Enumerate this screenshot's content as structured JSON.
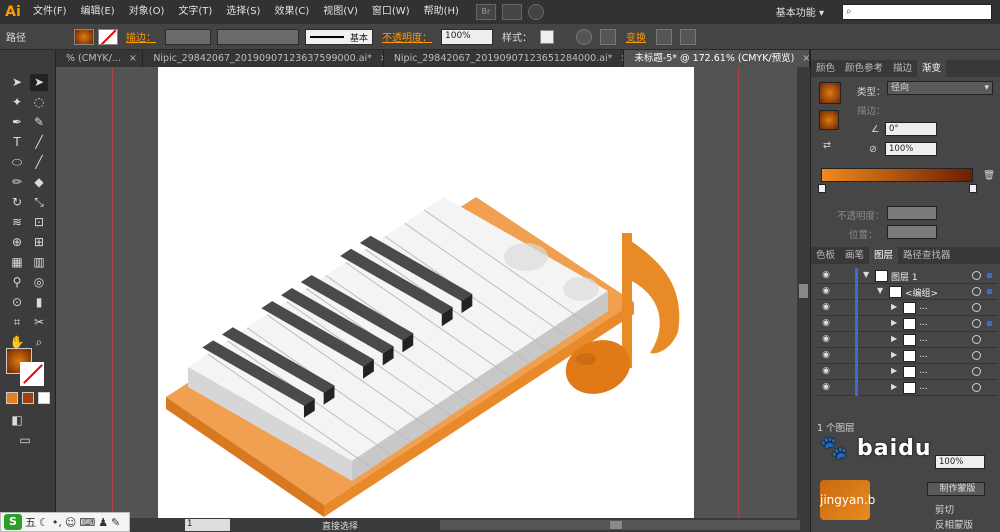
{
  "app": {
    "logo": "Ai"
  },
  "menu": [
    "文件(F)",
    "编辑(E)",
    "对象(O)",
    "文字(T)",
    "选择(S)",
    "效果(C)",
    "视图(V)",
    "窗口(W)",
    "帮助(H)"
  ],
  "menu_extra": {
    "br_label": "Br"
  },
  "workspace": {
    "label": "基本功能",
    "arrow": "▾"
  },
  "search": {
    "placeholder": ""
  },
  "control": {
    "selection_label": "路径",
    "stroke_label": "描边：",
    "brush_label": "基本",
    "opacity_label": "不透明度：",
    "opacity_value": "100%",
    "style_label": "样式：",
    "transform_label": "变换"
  },
  "tabs": [
    {
      "label": "% (CMYK/...",
      "active": false
    },
    {
      "label": "Nipic_29842067_20190907123637599000.ai*",
      "active": false
    },
    {
      "label": "Nipic_29842067_20190907123651284000.ai*",
      "active": false
    },
    {
      "label": "未标题-5* @ 172.61% (CMYK/预览)",
      "active": true
    }
  ],
  "tab_close": "×",
  "status": {
    "page_value": "1",
    "tool_name": "直接选择"
  },
  "gradient_panel": {
    "tabs": [
      {
        "label": "颜色",
        "active": false
      },
      {
        "label": "颜色参考",
        "active": false
      },
      {
        "label": "描边",
        "active": false
      },
      {
        "label": "渐变",
        "active": true
      }
    ],
    "type_label": "类型：",
    "type_value": "径向",
    "stroke_label": "描边：",
    "angle_value": "0°",
    "aspect_value": "100%",
    "opacity_label": "不透明度：",
    "position_label": "位置："
  },
  "layers_panel": {
    "tabs": [
      {
        "label": "色板",
        "active": false
      },
      {
        "label": "画笔",
        "active": false
      },
      {
        "label": "图层",
        "active": true
      },
      {
        "label": "路径查找器",
        "active": false
      }
    ],
    "rows": [
      {
        "name": "图层 1",
        "indent": 0,
        "expanded": true
      },
      {
        "name": "<编组>",
        "indent": 1,
        "expanded": true
      },
      {
        "name": "...",
        "indent": 2,
        "expanded": false
      },
      {
        "name": "...",
        "indent": 2,
        "expanded": false
      },
      {
        "name": "...",
        "indent": 2,
        "expanded": false
      },
      {
        "name": "...",
        "indent": 2,
        "expanded": false
      },
      {
        "name": "...",
        "indent": 2,
        "expanded": false
      },
      {
        "name": "...",
        "indent": 2,
        "expanded": false
      }
    ],
    "footer_label": "1 个图层"
  },
  "transparency_panel": {
    "opacity_value": "100%",
    "mask_button": "制作蒙版",
    "clip_label": "剪切",
    "invert_label": "反相蒙版"
  },
  "watermark": {
    "text": "jingyan.b"
  },
  "colors": {
    "accent": "#ff9a00",
    "piano_base": "#e8892a",
    "note": "#e07a14",
    "black_key": "#3a3a3a",
    "white_key": "#f2f2f2"
  },
  "ime": {
    "s": "S",
    "char": "五"
  }
}
